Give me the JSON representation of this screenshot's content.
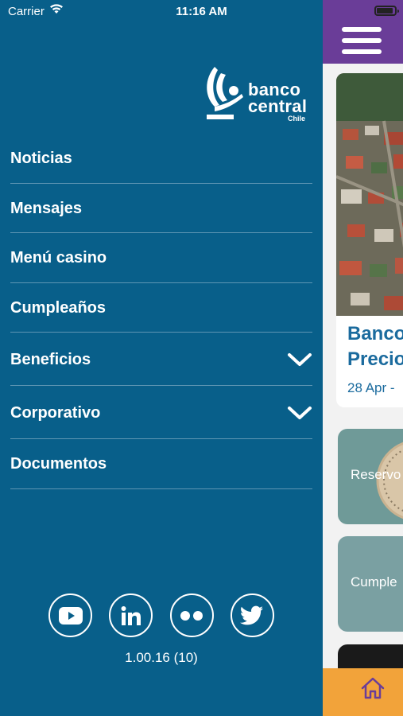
{
  "status_bar": {
    "carrier": "Carrier",
    "time": "11:16 AM"
  },
  "logo": {
    "line1": "banco",
    "line2": "central",
    "line3": "Chile"
  },
  "menu": {
    "items": [
      {
        "label": "Noticias",
        "expandable": false
      },
      {
        "label": "Mensajes",
        "expandable": false
      },
      {
        "label": "Menú casino",
        "expandable": false
      },
      {
        "label": "Cumpleaños",
        "expandable": false
      },
      {
        "label": "Beneficios",
        "expandable": true
      },
      {
        "label": "Corporativo",
        "expandable": true
      },
      {
        "label": "Documentos",
        "expandable": false
      }
    ]
  },
  "social": [
    {
      "icon": "youtube-icon"
    },
    {
      "icon": "linkedin-icon"
    },
    {
      "icon": "flickr-icon"
    },
    {
      "icon": "twitter-icon"
    }
  ],
  "version": "1.00.16 (10)",
  "background_content": {
    "card_title_line1": "Banco",
    "card_title_line2": "Precio",
    "card_date": "28 Apr -",
    "card2_text": "Reservo",
    "card3_text": "Cumple"
  },
  "colors": {
    "drawer_bg": "#085f8a",
    "topbar": "#6a3d98",
    "accent_text": "#1b6b9e",
    "bottom_bar": "#f2a33a"
  }
}
